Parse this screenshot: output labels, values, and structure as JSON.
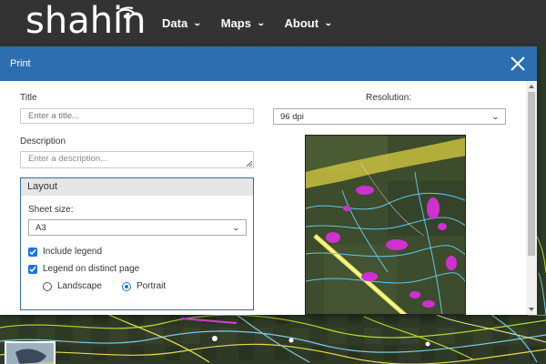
{
  "app": {
    "logo_text": "shahin"
  },
  "nav": {
    "items": [
      {
        "label": "Data"
      },
      {
        "label": "Maps"
      },
      {
        "label": "About"
      }
    ]
  },
  "dialog": {
    "title": "Print",
    "title_label": "Title",
    "title_placeholder": "Enter a title...",
    "description_label": "Description",
    "description_placeholder": "Enter a description...",
    "resolution_label": "Resolution:",
    "resolution_value": "96 dpi",
    "layout": {
      "header": "Layout",
      "sheet_size_label": "Sheet size:",
      "sheet_size_value": "A3",
      "include_legend": {
        "label": "Include legend",
        "checked": true
      },
      "legend_distinct_page": {
        "label": "Legend on distinct page",
        "checked": true
      },
      "orientation": {
        "options": [
          {
            "label": "Landscape",
            "selected": false
          },
          {
            "label": "Portrait",
            "selected": true
          }
        ]
      }
    }
  },
  "colors": {
    "navbar": "#333333",
    "dialog_header": "#2c6eb0",
    "accent": "#1a73e8"
  }
}
